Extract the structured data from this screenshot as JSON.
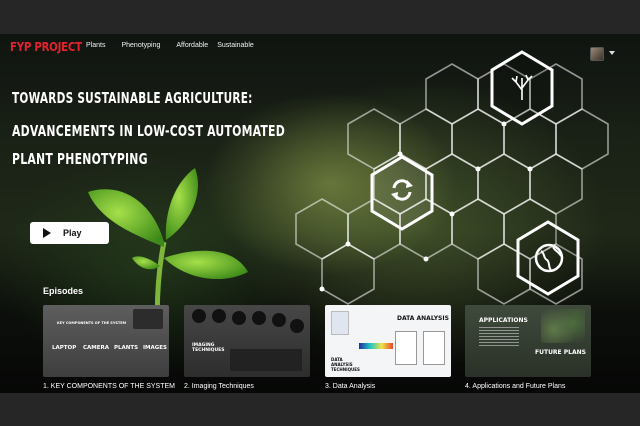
{
  "nav": {
    "brand": "FYP PROJECT",
    "links": [
      "Plants",
      "Phenotyping",
      "Affordable",
      "Sustainable"
    ]
  },
  "hero": {
    "line1": "TOWARDS SUSTAINABLE AGRICULTURE:",
    "line2": "ADVANCEMENTS IN LOW-COST AUTOMATED",
    "line3": "PLANT PHENOTYPING",
    "play_label": "Play"
  },
  "episodes": {
    "heading": "Episodes",
    "items": [
      {
        "label": "1.  KEY COMPONENTS OF THE SYSTEM",
        "thumb_title": "KEY COMPONENTS OF THE SYSTEM",
        "thumb_words": [
          "LAPTOP",
          "CAMERA",
          "PLANTS",
          "IMAGES"
        ]
      },
      {
        "label": "2. Imaging Techniques",
        "thumb_title": "IMAGING TECHNIQUES"
      },
      {
        "label": "3. Data Analysis",
        "thumb_title": "DATA ANALYSIS",
        "thumb_sub": "DATA ANALYSIS TECHNIQUES"
      },
      {
        "label": "4.  Applications and Future Plans",
        "thumb_title": "APPLICATIONS",
        "thumb_sub": "FUTURE PLANS"
      }
    ]
  },
  "colors": {
    "brand": "#e3222b",
    "background": "#1a2116",
    "play_button": "#ffffff"
  },
  "icons": [
    "tree-icon",
    "refresh-icon",
    "globe-icon",
    "play-icon",
    "avatar",
    "chevron-down-icon"
  ]
}
